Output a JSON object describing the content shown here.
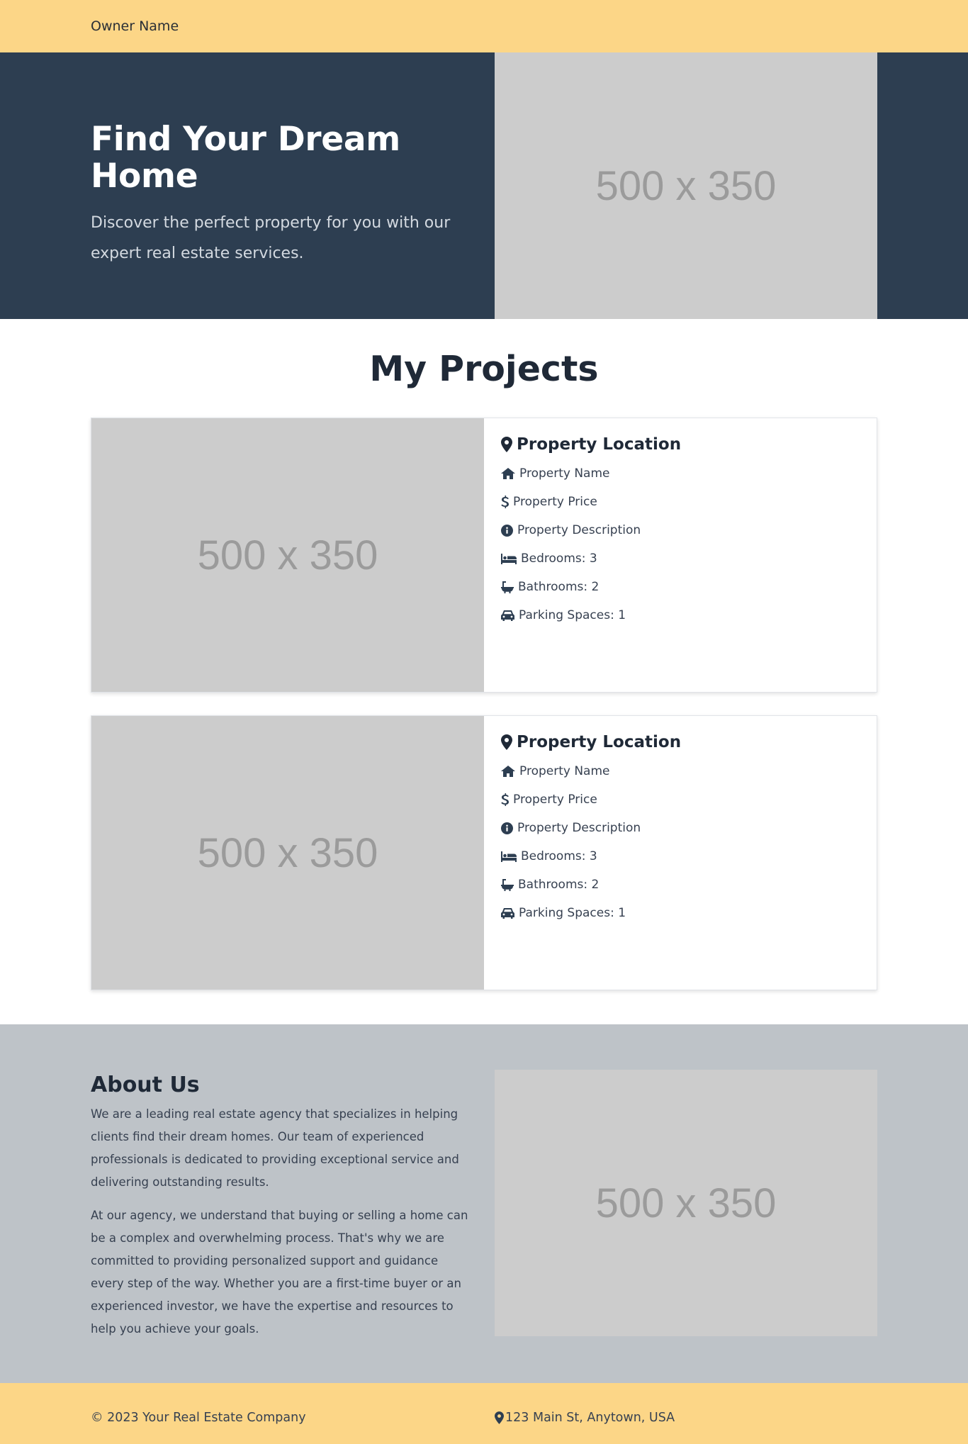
{
  "header": {
    "owner_name": "Owner Name"
  },
  "hero": {
    "title": "Find Your Dream Home",
    "subtitle": "Discover the perfect property for you with our expert real estate services.",
    "image_label": "500 x 350"
  },
  "projects": {
    "title": "My Projects",
    "cards": [
      {
        "image_label": "500 x 350",
        "location": "Property Location",
        "name": "Property Name",
        "price": "Property Price",
        "description": "Property Description",
        "bedrooms": "Bedrooms: 3",
        "bathrooms": "Bathrooms: 2",
        "parking": "Parking Spaces: 1"
      },
      {
        "image_label": "500 x 350",
        "location": "Property Location",
        "name": "Property Name",
        "price": "Property Price",
        "description": "Property Description",
        "bedrooms": "Bedrooms: 3",
        "bathrooms": "Bathrooms: 2",
        "parking": "Parking Spaces: 1"
      }
    ]
  },
  "about": {
    "title": "About Us",
    "paragraphs": [
      "We are a leading real estate agency that specializes in helping clients find their dream homes. Our team of experienced professionals is dedicated to providing exceptional service and delivering outstanding results.",
      "At our agency, we understand that buying or selling a home can be a complex and overwhelming process. That's why we are committed to providing personalized support and guidance every step of the way. Whether you are a first-time buyer or an experienced investor, we have the expertise and resources to help you achieve your goals."
    ],
    "image_label": "500 x 350"
  },
  "footer": {
    "copyright": "© 2023 Your Real Estate Company",
    "address": "123 Main St, Anytown, USA"
  },
  "colors": {
    "accent_yellow": "#fcd687",
    "hero_navy": "#2d3e51",
    "about_gray": "#bec3c8",
    "placeholder_gray": "#cccccc"
  },
  "icons": [
    "map-marker-icon",
    "home-icon",
    "dollar-icon",
    "info-circle-icon",
    "bed-icon",
    "bath-icon",
    "car-icon"
  ]
}
